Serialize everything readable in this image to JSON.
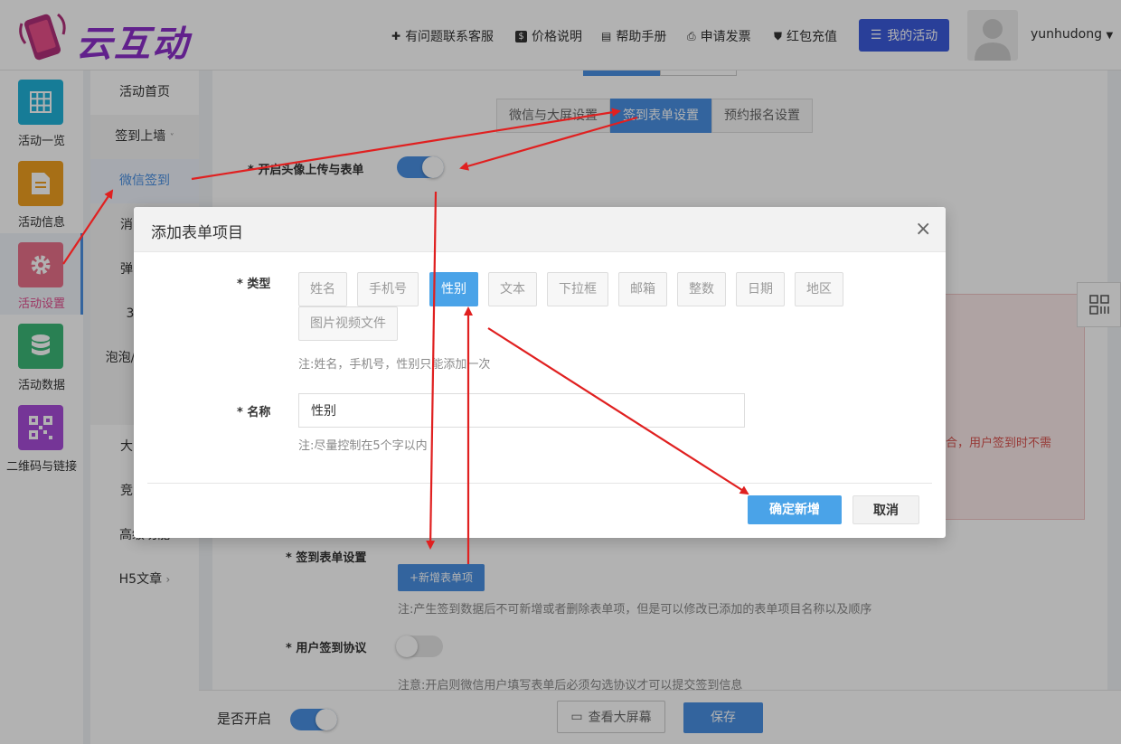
{
  "header": {
    "logo_text": "云互动",
    "nav": [
      {
        "icon": "add-user-icon",
        "label": "有问题联系客服"
      },
      {
        "icon": "dollar-icon",
        "label": "价格说明"
      },
      {
        "icon": "book-icon",
        "label": "帮助手册"
      },
      {
        "icon": "printer-icon",
        "label": "申请发票"
      },
      {
        "icon": "shield-check-icon",
        "label": "红包充值"
      }
    ],
    "my_activity_label": "我的活动",
    "username": "yunhudong"
  },
  "sidebar": {
    "items": [
      {
        "label": "活动一览",
        "icon": "grid-icon",
        "color": "#20b2d8"
      },
      {
        "label": "活动信息",
        "icon": "document-icon",
        "color": "#f0a020"
      },
      {
        "label": "活动设置",
        "icon": "gear-icon",
        "color": "#e8708a"
      },
      {
        "label": "活动数据",
        "icon": "database-icon",
        "color": "#3cb878"
      },
      {
        "label": "二维码与链接",
        "icon": "qrcode-icon",
        "color": "#a84cd8"
      }
    ]
  },
  "subnav": {
    "items": [
      "活动首页",
      "签到上墙",
      "微信签到",
      "消",
      "弹",
      "3I",
      "泡泡/",
      "",
      "大",
      "竞",
      "高级功能",
      "H5文章"
    ]
  },
  "main": {
    "tabs": [
      "微信与大屏设置",
      "签到表单设置",
      "预约报名设置"
    ],
    "avatar_upload_label": "* 开启头像上传与表单",
    "signin_form_label": "* 签到表单设置",
    "add_item_label": "+新增表单项",
    "add_item_note": "注:产生签到数据后不可新增或者删除表单项，但是可以修改已添加的表单项目名称以及顺序",
    "agreement_label": "* 用户签到协议",
    "agreement_note": "注意:开启则微信用户填写表单后必须勾选协议才可以提交签到信息",
    "pink_text": "合，用户签到时不需"
  },
  "bottom": {
    "enable_label": "是否开启",
    "preview_label": "查看大屏幕",
    "save_label": "保存"
  },
  "modal": {
    "title": "添加表单项目",
    "type_label": "* 类型",
    "types": [
      "姓名",
      "手机号",
      "性别",
      "文本",
      "下拉框",
      "邮箱",
      "整数",
      "日期",
      "地区",
      "图片视频文件"
    ],
    "selected_type": "性别",
    "type_note": "注:姓名，手机号，性别只能添加一次",
    "name_label": "* 名称",
    "name_value": "性别",
    "name_note": "注:尽量控制在5个字以内",
    "confirm_label": "确定新增",
    "cancel_label": "取消",
    "close_glyph": "×"
  },
  "colors": {
    "accent": "#4a90e2",
    "annotation_arrow": "#e02020",
    "brand": "#8b2fc9"
  }
}
